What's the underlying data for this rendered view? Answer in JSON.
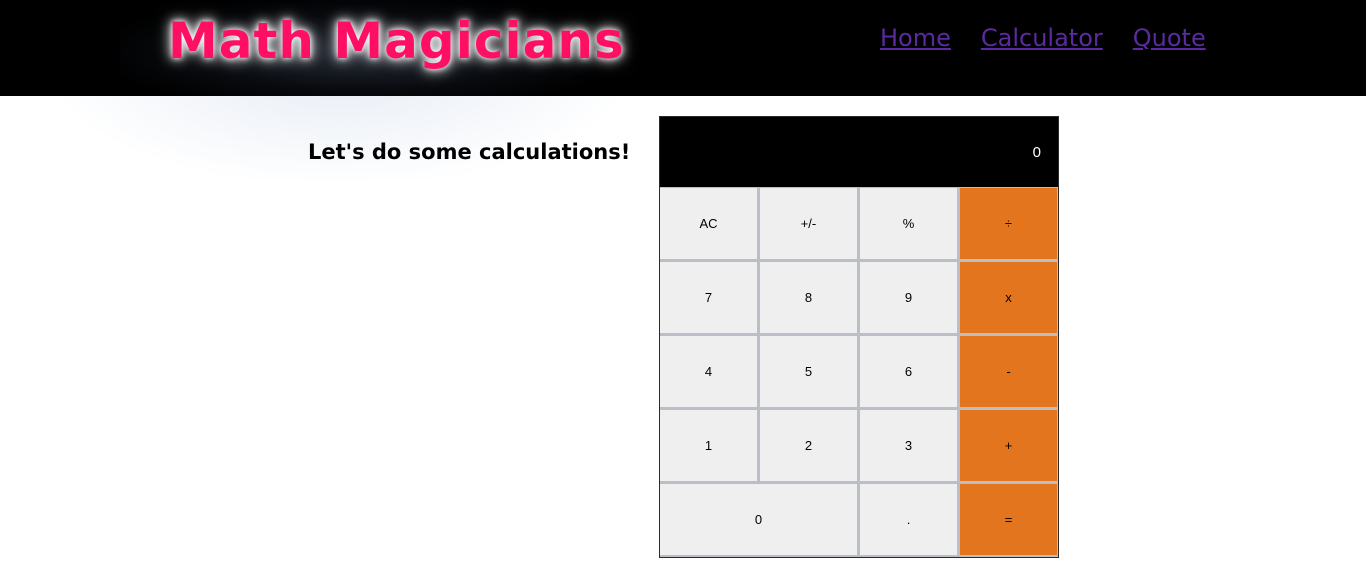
{
  "header": {
    "logo": "Math Magicians",
    "nav": [
      {
        "label": "Home"
      },
      {
        "label": "Calculator"
      },
      {
        "label": "Quote"
      }
    ]
  },
  "main": {
    "heading": "Let's do some calculations!"
  },
  "calculator": {
    "display": "0",
    "keys": [
      {
        "label": "AC"
      },
      {
        "label": "+/-"
      },
      {
        "label": "%"
      },
      {
        "label": "÷"
      },
      {
        "label": "7"
      },
      {
        "label": "8"
      },
      {
        "label": "9"
      },
      {
        "label": "x"
      },
      {
        "label": "4"
      },
      {
        "label": "5"
      },
      {
        "label": "6"
      },
      {
        "label": "-"
      },
      {
        "label": "1"
      },
      {
        "label": "2"
      },
      {
        "label": "3"
      },
      {
        "label": "+"
      },
      {
        "label": "0"
      },
      {
        "label": "."
      },
      {
        "label": "="
      }
    ]
  },
  "colors": {
    "header_bg": "#000000",
    "logo": "#ff0f63",
    "nav_link": "#5b2aa1",
    "operator_key": "#e3751f",
    "number_key": "#efefef",
    "key_gap": "#b9bec7",
    "display_bg": "#000000"
  }
}
